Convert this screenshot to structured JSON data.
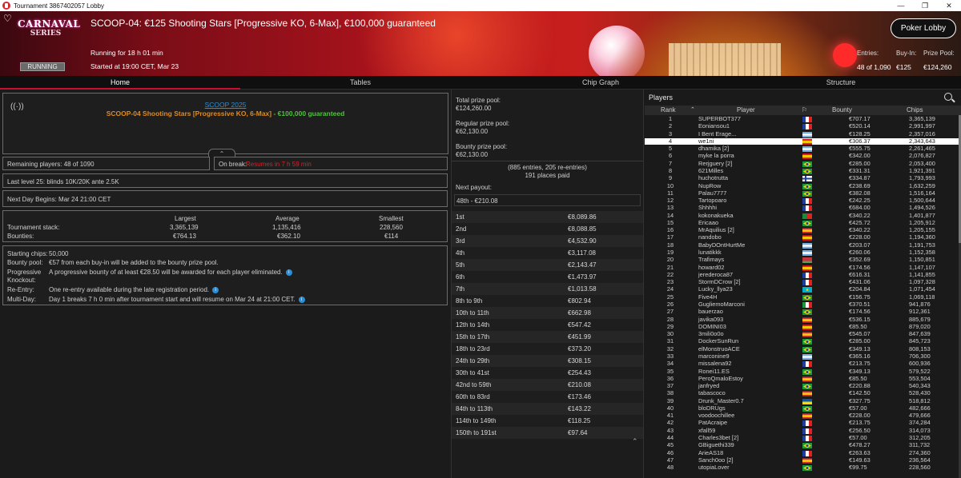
{
  "window": {
    "title": "Tournament 3867402057 Lobby"
  },
  "banner": {
    "logo_line1": "CARNAVAL",
    "logo_line2": "SERIES",
    "status": "RUNNING",
    "title": "SCOOP-04: €125 Shooting Stars [Progressive KO, 6-Max], €100,000 guaranteed",
    "running_for": "Running for 18 h 01 min",
    "started_at": "Started at 19:00 CET, Mar 23",
    "lobby_button": "Poker Lobby",
    "entries_label": "Entries:",
    "entries_value": "48 of 1,090",
    "buyin_label": "Buy-In:",
    "buyin_value": "€125",
    "prizepool_label": "Prize Pool:",
    "prizepool_value": "€124,260"
  },
  "tabs": [
    "Home",
    "Tables",
    "Chip Graph",
    "Structure"
  ],
  "home": {
    "series_link": "SCOOP 2025",
    "tourney_name_orange": "SCOOP-04 Shooting Stars [Progressive KO, 6-Max]",
    "tourney_name_green": " - €100,000 guaranteed",
    "remaining": "Remaining players: 48 of 1090",
    "on_break_label": "On break:",
    "on_break_value": "Resumes in 7 h 59 min",
    "last_level": "Last level 25:  blinds 10K/20K ante 2.5K",
    "next_day": "Next Day Begins:  Mar 24 21:00 CET",
    "stack_headers": [
      "Largest",
      "Average",
      "Smallest"
    ],
    "stack_label": "Tournament stack:",
    "stack_values": [
      "3,365,139",
      "1,135,416",
      "228,560"
    ],
    "bounties_label": "Bounties:",
    "bounties_values": [
      "€764.13",
      "€362.10",
      "€114"
    ],
    "starting_chips_label": "Starting chips:",
    "starting_chips_value": "50,000",
    "bounty_pool_label": "Bounty pool:",
    "bounty_pool_value": "€57 from each buy-in will be added to the bounty prize pool.",
    "progressive_label1": "Progressive",
    "progressive_label2": "Knockout:",
    "progressive_value": "A progressive bounty of at least €28.50 will be awarded for each player eliminated.",
    "reentry_label": "Re-Entry:",
    "reentry_value": "One re-entry available during the late registration period.",
    "multiday_label": "Multi-Day:",
    "multiday_value": "Day 1 breaks 7 h 0 min after tournament start and will resume on Mar 24 at 21:00 CET."
  },
  "prizes": {
    "total_label": "Total prize pool:",
    "total_value": "€124,260.00",
    "regular_label": "Regular prize pool:",
    "regular_value": "€62,130.00",
    "bounty_label": "Bounty prize pool:",
    "bounty_value": "€62,130.00",
    "entries_note": "(885 entries, 205 re-entries)",
    "places_paid": "191 places paid",
    "next_payout_label": "Next payout:",
    "next_payout_value": "48th - €210.08",
    "payouts": [
      [
        "1st",
        "€8,089.86"
      ],
      [
        "2nd",
        "€8,088.85"
      ],
      [
        "3rd",
        "€4,532.90"
      ],
      [
        "4th",
        "€3,117.08"
      ],
      [
        "5th",
        "€2,143.47"
      ],
      [
        "6th",
        "€1,473.97"
      ],
      [
        "7th",
        "€1,013.58"
      ],
      [
        "8th to 9th",
        "€802.94"
      ],
      [
        "10th to 11th",
        "€662.98"
      ],
      [
        "12th to 14th",
        "€547.42"
      ],
      [
        "15th to 17th",
        "€451.99"
      ],
      [
        "18th to 23rd",
        "€373.20"
      ],
      [
        "24th to 29th",
        "€308.15"
      ],
      [
        "30th to 41st",
        "€254.43"
      ],
      [
        "42nd to 59th",
        "€210.08"
      ],
      [
        "60th to 83rd",
        "€173.46"
      ],
      [
        "84th to 113th",
        "€143.22"
      ],
      [
        "114th to 149th",
        "€118.25"
      ],
      [
        "150th to 191st",
        "€97.64"
      ]
    ]
  },
  "players": {
    "title": "Players",
    "headers": [
      "Rank",
      "Player",
      "Bounty",
      "Chips"
    ],
    "rows": [
      [
        "1",
        "SUPERBOT377",
        "€707.17",
        "3,365,139",
        "fr"
      ],
      [
        "2",
        "Eoniansou1",
        "€520.14",
        "2,991,997",
        "fr"
      ],
      [
        "3",
        "I Bent Erage...",
        "€128.25",
        "2,357,016",
        "ar"
      ],
      [
        "4",
        "we1ni",
        "€306.37",
        "2,343,643",
        "es"
      ],
      [
        "5",
        "dhamika [2]",
        "€555.75",
        "2,261,465",
        "ar"
      ],
      [
        "6",
        "myke la porra",
        "€342.00",
        "2,076,827",
        "es"
      ],
      [
        "7",
        "Rerjguery [2]",
        "€285.00",
        "2,053,400",
        "br"
      ],
      [
        "8",
        "621Milles",
        "€331.31",
        "1,921,391",
        "br"
      ],
      [
        "9",
        "huchotrutta",
        "€334.87",
        "1,793,993",
        "fi"
      ],
      [
        "10",
        "NupRow",
        "€238.69",
        "1,632,259",
        "br"
      ],
      [
        "11",
        "Palau7777",
        "€382.08",
        "1,516,164",
        "br"
      ],
      [
        "12",
        "Tartopoaro",
        "€242.25",
        "1,500,644",
        "fr"
      ],
      [
        "13",
        "Shhhhi",
        "€684.00",
        "1,494,526",
        "fr"
      ],
      [
        "14",
        "kokonakueka",
        "€340.22",
        "1,401,877",
        "pt"
      ],
      [
        "15",
        "Ericaao",
        "€425.72",
        "1,205,912",
        "br"
      ],
      [
        "16",
        "MrAquilius [2]",
        "€340.22",
        "1,205,155",
        "es"
      ],
      [
        "17",
        "nandobo",
        "€228.00",
        "1,194,360",
        "es"
      ],
      [
        "18",
        "BabyDOntHurtMe",
        "€203.07",
        "1,191,753",
        "ar"
      ],
      [
        "19",
        "lunatikkk",
        "€260.06",
        "1,152,358",
        "ar"
      ],
      [
        "20",
        "Trafimays",
        "€352.69",
        "1,150,851",
        "by"
      ],
      [
        "21",
        "howard02",
        "€174.56",
        "1,147,107",
        "es"
      ],
      [
        "22",
        "jerederoca87",
        "€616.31",
        "1,141,855",
        "fr"
      ],
      [
        "23",
        "StormDCrow [2]",
        "€431.06",
        "1,097,328",
        "fr"
      ],
      [
        "24",
        "Lucky_llya23",
        "€204.84",
        "1,071,454",
        "kz"
      ],
      [
        "25",
        "Five4H",
        "€156.75",
        "1,069,118",
        "br"
      ],
      [
        "26",
        "GugliemoMarconi",
        "€370.51",
        "941,876",
        "it"
      ],
      [
        "27",
        "bauerzao",
        "€174.56",
        "912,361",
        "br"
      ],
      [
        "28",
        "javika093",
        "€536.15",
        "885,679",
        "es"
      ],
      [
        "29",
        "DOMINI03",
        "€85.50",
        "879,020",
        "es"
      ],
      [
        "30",
        "3mili0o0o",
        "€545.07",
        "847,639",
        "es"
      ],
      [
        "31",
        "DockerSunRun",
        "€285.00",
        "845,723",
        "br"
      ],
      [
        "32",
        "elMonstruoACE",
        "€349.13",
        "808,153",
        "br"
      ],
      [
        "33",
        "marconine9",
        "€365.16",
        "706,300",
        "ar"
      ],
      [
        "34",
        "missalena92",
        "€213.75",
        "600,936",
        "fr"
      ],
      [
        "35",
        "Ronei11.ES",
        "€349.13",
        "579,522",
        "br"
      ],
      [
        "36",
        "PeroQmaloEstoy",
        "€85.50",
        "553,504",
        "es"
      ],
      [
        "37",
        "janfryed",
        "€220.88",
        "540,343",
        "br"
      ],
      [
        "38",
        "tabascoco",
        "€142.50",
        "528,430",
        "es"
      ],
      [
        "39",
        "Drunk_Master0.7",
        "€327.75",
        "518,812",
        "ua"
      ],
      [
        "40",
        "bloDRUgs",
        "€57.00",
        "482,666",
        "br"
      ],
      [
        "41",
        "voodoochillee",
        "€228.00",
        "479,666",
        "es"
      ],
      [
        "42",
        "PatAcraipe",
        "€213.75",
        "374,284",
        "fr"
      ],
      [
        "43",
        "xfall59",
        "€256.50",
        "314,073",
        "fr"
      ],
      [
        "44",
        "Charles3bet [2]",
        "€57.00",
        "312,205",
        "fr"
      ],
      [
        "45",
        "GBiguethi339",
        "€478.27",
        "311,732",
        "br"
      ],
      [
        "46",
        "ArieAS18",
        "€263.63",
        "274,360",
        "fr"
      ],
      [
        "47",
        "Sanch0oo [2]",
        "€149.63",
        "236,564",
        "es"
      ],
      [
        "48",
        "utopiaLover",
        "€99.75",
        "228,560",
        "br"
      ]
    ]
  },
  "colors": {
    "accent": "#c8102e",
    "link": "#2c8fd4",
    "orange": "#e08a1e",
    "green": "#4fc23c",
    "red": "#d8232a"
  }
}
